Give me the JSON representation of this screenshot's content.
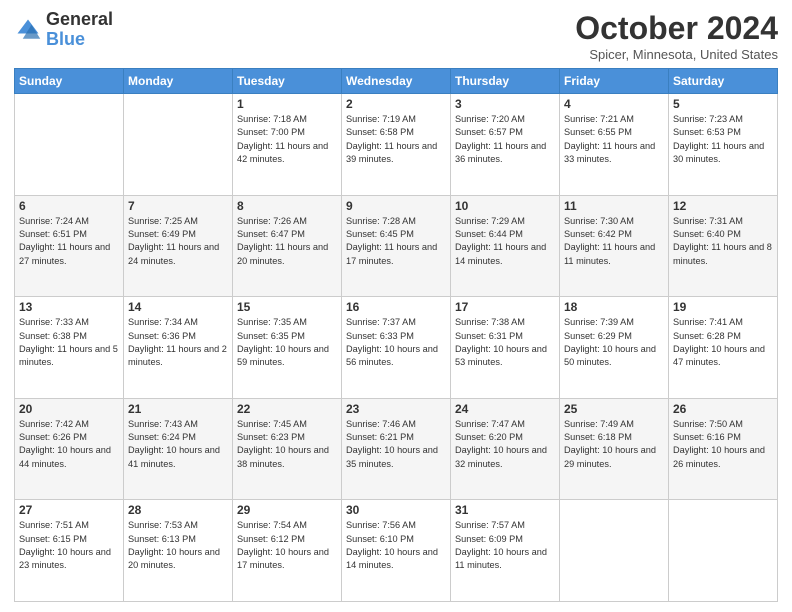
{
  "header": {
    "logo_general": "General",
    "logo_blue": "Blue",
    "title": "October 2024",
    "location": "Spicer, Minnesota, United States"
  },
  "weekdays": [
    "Sunday",
    "Monday",
    "Tuesday",
    "Wednesday",
    "Thursday",
    "Friday",
    "Saturday"
  ],
  "weeks": [
    [
      {
        "day": "",
        "sunrise": "",
        "sunset": "",
        "daylight": ""
      },
      {
        "day": "",
        "sunrise": "",
        "sunset": "",
        "daylight": ""
      },
      {
        "day": "1",
        "sunrise": "Sunrise: 7:18 AM",
        "sunset": "Sunset: 7:00 PM",
        "daylight": "Daylight: 11 hours and 42 minutes."
      },
      {
        "day": "2",
        "sunrise": "Sunrise: 7:19 AM",
        "sunset": "Sunset: 6:58 PM",
        "daylight": "Daylight: 11 hours and 39 minutes."
      },
      {
        "day": "3",
        "sunrise": "Sunrise: 7:20 AM",
        "sunset": "Sunset: 6:57 PM",
        "daylight": "Daylight: 11 hours and 36 minutes."
      },
      {
        "day": "4",
        "sunrise": "Sunrise: 7:21 AM",
        "sunset": "Sunset: 6:55 PM",
        "daylight": "Daylight: 11 hours and 33 minutes."
      },
      {
        "day": "5",
        "sunrise": "Sunrise: 7:23 AM",
        "sunset": "Sunset: 6:53 PM",
        "daylight": "Daylight: 11 hours and 30 minutes."
      }
    ],
    [
      {
        "day": "6",
        "sunrise": "Sunrise: 7:24 AM",
        "sunset": "Sunset: 6:51 PM",
        "daylight": "Daylight: 11 hours and 27 minutes."
      },
      {
        "day": "7",
        "sunrise": "Sunrise: 7:25 AM",
        "sunset": "Sunset: 6:49 PM",
        "daylight": "Daylight: 11 hours and 24 minutes."
      },
      {
        "day": "8",
        "sunrise": "Sunrise: 7:26 AM",
        "sunset": "Sunset: 6:47 PM",
        "daylight": "Daylight: 11 hours and 20 minutes."
      },
      {
        "day": "9",
        "sunrise": "Sunrise: 7:28 AM",
        "sunset": "Sunset: 6:45 PM",
        "daylight": "Daylight: 11 hours and 17 minutes."
      },
      {
        "day": "10",
        "sunrise": "Sunrise: 7:29 AM",
        "sunset": "Sunset: 6:44 PM",
        "daylight": "Daylight: 11 hours and 14 minutes."
      },
      {
        "day": "11",
        "sunrise": "Sunrise: 7:30 AM",
        "sunset": "Sunset: 6:42 PM",
        "daylight": "Daylight: 11 hours and 11 minutes."
      },
      {
        "day": "12",
        "sunrise": "Sunrise: 7:31 AM",
        "sunset": "Sunset: 6:40 PM",
        "daylight": "Daylight: 11 hours and 8 minutes."
      }
    ],
    [
      {
        "day": "13",
        "sunrise": "Sunrise: 7:33 AM",
        "sunset": "Sunset: 6:38 PM",
        "daylight": "Daylight: 11 hours and 5 minutes."
      },
      {
        "day": "14",
        "sunrise": "Sunrise: 7:34 AM",
        "sunset": "Sunset: 6:36 PM",
        "daylight": "Daylight: 11 hours and 2 minutes."
      },
      {
        "day": "15",
        "sunrise": "Sunrise: 7:35 AM",
        "sunset": "Sunset: 6:35 PM",
        "daylight": "Daylight: 10 hours and 59 minutes."
      },
      {
        "day": "16",
        "sunrise": "Sunrise: 7:37 AM",
        "sunset": "Sunset: 6:33 PM",
        "daylight": "Daylight: 10 hours and 56 minutes."
      },
      {
        "day": "17",
        "sunrise": "Sunrise: 7:38 AM",
        "sunset": "Sunset: 6:31 PM",
        "daylight": "Daylight: 10 hours and 53 minutes."
      },
      {
        "day": "18",
        "sunrise": "Sunrise: 7:39 AM",
        "sunset": "Sunset: 6:29 PM",
        "daylight": "Daylight: 10 hours and 50 minutes."
      },
      {
        "day": "19",
        "sunrise": "Sunrise: 7:41 AM",
        "sunset": "Sunset: 6:28 PM",
        "daylight": "Daylight: 10 hours and 47 minutes."
      }
    ],
    [
      {
        "day": "20",
        "sunrise": "Sunrise: 7:42 AM",
        "sunset": "Sunset: 6:26 PM",
        "daylight": "Daylight: 10 hours and 44 minutes."
      },
      {
        "day": "21",
        "sunrise": "Sunrise: 7:43 AM",
        "sunset": "Sunset: 6:24 PM",
        "daylight": "Daylight: 10 hours and 41 minutes."
      },
      {
        "day": "22",
        "sunrise": "Sunrise: 7:45 AM",
        "sunset": "Sunset: 6:23 PM",
        "daylight": "Daylight: 10 hours and 38 minutes."
      },
      {
        "day": "23",
        "sunrise": "Sunrise: 7:46 AM",
        "sunset": "Sunset: 6:21 PM",
        "daylight": "Daylight: 10 hours and 35 minutes."
      },
      {
        "day": "24",
        "sunrise": "Sunrise: 7:47 AM",
        "sunset": "Sunset: 6:20 PM",
        "daylight": "Daylight: 10 hours and 32 minutes."
      },
      {
        "day": "25",
        "sunrise": "Sunrise: 7:49 AM",
        "sunset": "Sunset: 6:18 PM",
        "daylight": "Daylight: 10 hours and 29 minutes."
      },
      {
        "day": "26",
        "sunrise": "Sunrise: 7:50 AM",
        "sunset": "Sunset: 6:16 PM",
        "daylight": "Daylight: 10 hours and 26 minutes."
      }
    ],
    [
      {
        "day": "27",
        "sunrise": "Sunrise: 7:51 AM",
        "sunset": "Sunset: 6:15 PM",
        "daylight": "Daylight: 10 hours and 23 minutes."
      },
      {
        "day": "28",
        "sunrise": "Sunrise: 7:53 AM",
        "sunset": "Sunset: 6:13 PM",
        "daylight": "Daylight: 10 hours and 20 minutes."
      },
      {
        "day": "29",
        "sunrise": "Sunrise: 7:54 AM",
        "sunset": "Sunset: 6:12 PM",
        "daylight": "Daylight: 10 hours and 17 minutes."
      },
      {
        "day": "30",
        "sunrise": "Sunrise: 7:56 AM",
        "sunset": "Sunset: 6:10 PM",
        "daylight": "Daylight: 10 hours and 14 minutes."
      },
      {
        "day": "31",
        "sunrise": "Sunrise: 7:57 AM",
        "sunset": "Sunset: 6:09 PM",
        "daylight": "Daylight: 10 hours and 11 minutes."
      },
      {
        "day": "",
        "sunrise": "",
        "sunset": "",
        "daylight": ""
      },
      {
        "day": "",
        "sunrise": "",
        "sunset": "",
        "daylight": ""
      }
    ]
  ]
}
